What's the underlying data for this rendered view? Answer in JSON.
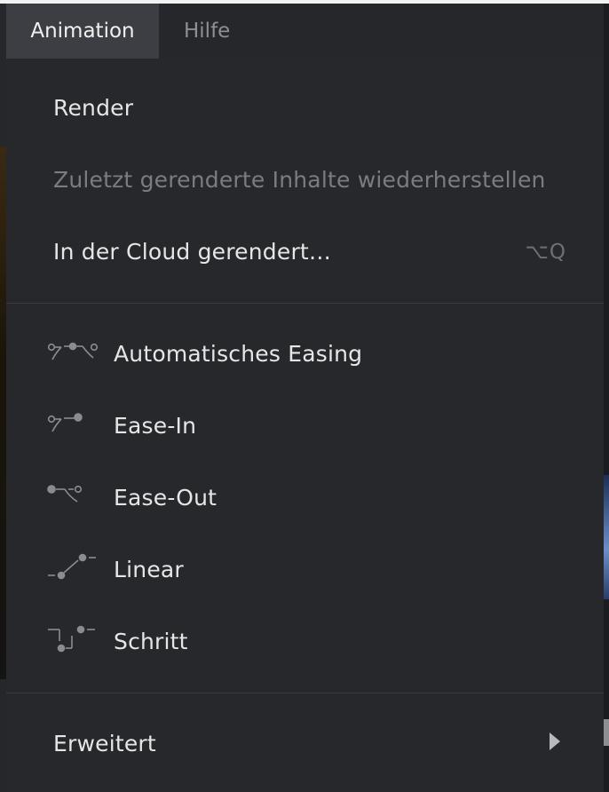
{
  "menubar": {
    "tabs": [
      {
        "label": "Animation",
        "active": true
      },
      {
        "label": "Hilfe",
        "active": false
      }
    ]
  },
  "dropdown": {
    "render_section": [
      {
        "label": "Render",
        "enabled": true
      },
      {
        "label": "Zuletzt gerenderte Inhalte wiederherstellen",
        "enabled": false
      },
      {
        "label": "In der Cloud gerendert…",
        "enabled": true,
        "shortcut": "⌥Q"
      }
    ],
    "easing_section": [
      {
        "label": "Automatisches Easing",
        "icon": "auto-easing-icon"
      },
      {
        "label": "Ease-In",
        "icon": "ease-in-icon"
      },
      {
        "label": "Ease-Out",
        "icon": "ease-out-icon"
      },
      {
        "label": "Linear",
        "icon": "linear-icon"
      },
      {
        "label": "Schritt",
        "icon": "step-icon"
      }
    ],
    "advanced": {
      "label": "Erweitert",
      "icon": "chevron-right-icon"
    }
  },
  "colors": {
    "menu_background": "#27282c",
    "active_tab_background": "#3d3e43",
    "text": "#e6e6e6",
    "disabled_text": "#7b7c81",
    "separator": "#3b3c41"
  }
}
